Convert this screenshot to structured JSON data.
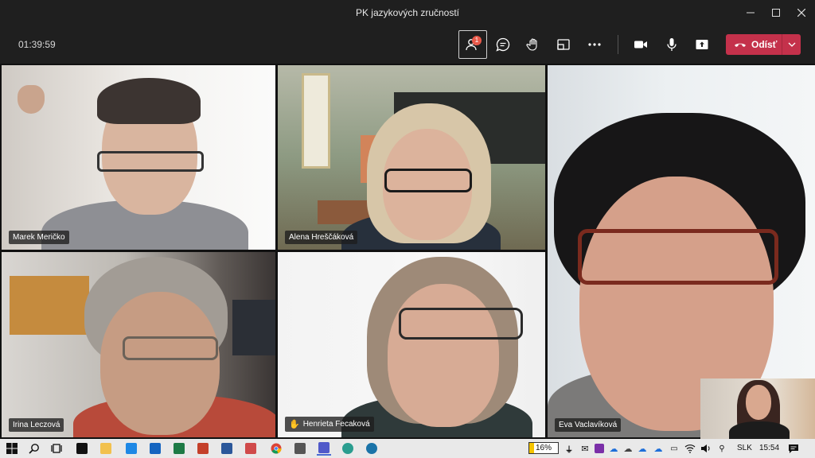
{
  "window": {
    "title": "PK jazykových zručností"
  },
  "toolbar": {
    "timer": "01:39:59",
    "participants_badge": "1",
    "leave_label": "Odísť",
    "colors": {
      "leave": "#c4314b",
      "badge": "#e8594a"
    }
  },
  "participants": [
    {
      "name": "Marek Meričko",
      "hand_raised": false
    },
    {
      "name": "Alena Hreščáková",
      "hand_raised": false
    },
    {
      "name": "Eva Vaclavíková",
      "hand_raised": false
    },
    {
      "name": "Irina Leczová",
      "hand_raised": false
    },
    {
      "name": "Henrieta Fecaková",
      "hand_raised": true
    }
  ],
  "taskbar": {
    "battery_percent": "16%",
    "battery_level": 0.16,
    "language": "SLK",
    "clock": "15:54"
  }
}
